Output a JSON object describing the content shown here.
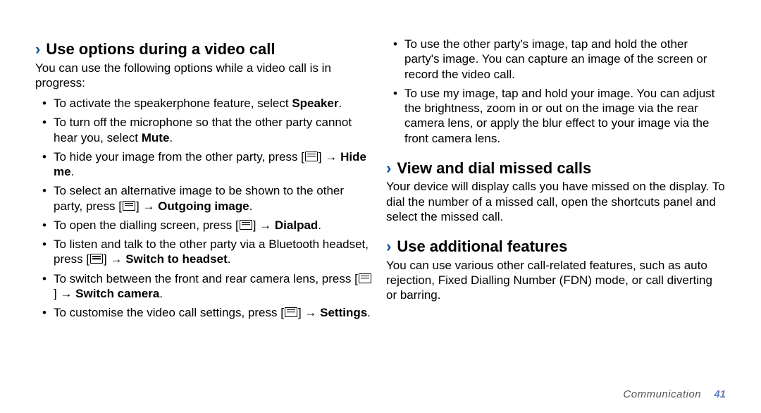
{
  "left": {
    "section1": {
      "title": "Use options during a video call",
      "intro": "You can use the following options while a video call is in progress:",
      "items": [
        {
          "pre": "To activate the speakerphone feature, select ",
          "bold": "Speaker",
          "post": "."
        },
        {
          "pre": "To turn off the microphone so that the other party cannot hear you, select ",
          "bold": "Mute",
          "post": "."
        },
        {
          "pre": "To hide your image from the other party, press [",
          "icon": true,
          "mid": "] → ",
          "bold": "Hide me",
          "post": "."
        },
        {
          "pre": "To select an alternative image to be shown to the other party, press [",
          "icon": true,
          "mid": "] → ",
          "bold": "Outgoing image",
          "post": "."
        },
        {
          "pre": "To open the dialling screen, press [",
          "icon": true,
          "mid": "] → ",
          "bold": "Dialpad",
          "post": "."
        },
        {
          "pre": "To listen and talk to the other party via a Bluetooth headset, press [",
          "icon": true,
          "mid": "] → ",
          "bold": "Switch to headset",
          "post": "."
        },
        {
          "pre": "To switch between the front and rear camera lens, press [",
          "icon": true,
          "mid": "] → ",
          "bold": "Switch camera",
          "post": "."
        },
        {
          "pre": "To customise the video call settings, press [",
          "icon": true,
          "mid": "] → ",
          "bold": "Settings",
          "post": "."
        }
      ]
    }
  },
  "right": {
    "cont_items": [
      {
        "text": "To use the other party's image, tap and hold the other party's image. You can capture an image of the screen or record the video call."
      },
      {
        "text": "To use my image, tap and hold your image. You can adjust the brightness, zoom in or out on the image via the rear camera lens, or apply the blur effect to your image via the front camera lens."
      }
    ],
    "section2": {
      "title": "View and dial missed calls",
      "intro": "Your device will display calls you have missed on the display. To dial the number of a missed call, open the shortcuts panel and select the missed call."
    },
    "section3": {
      "title": "Use additional features",
      "intro": "You can use various other call-related features, such as auto rejection, Fixed Dialling Number (FDN) mode, or call diverting or barring."
    }
  },
  "footer": {
    "section": "Communication",
    "page": "41"
  }
}
